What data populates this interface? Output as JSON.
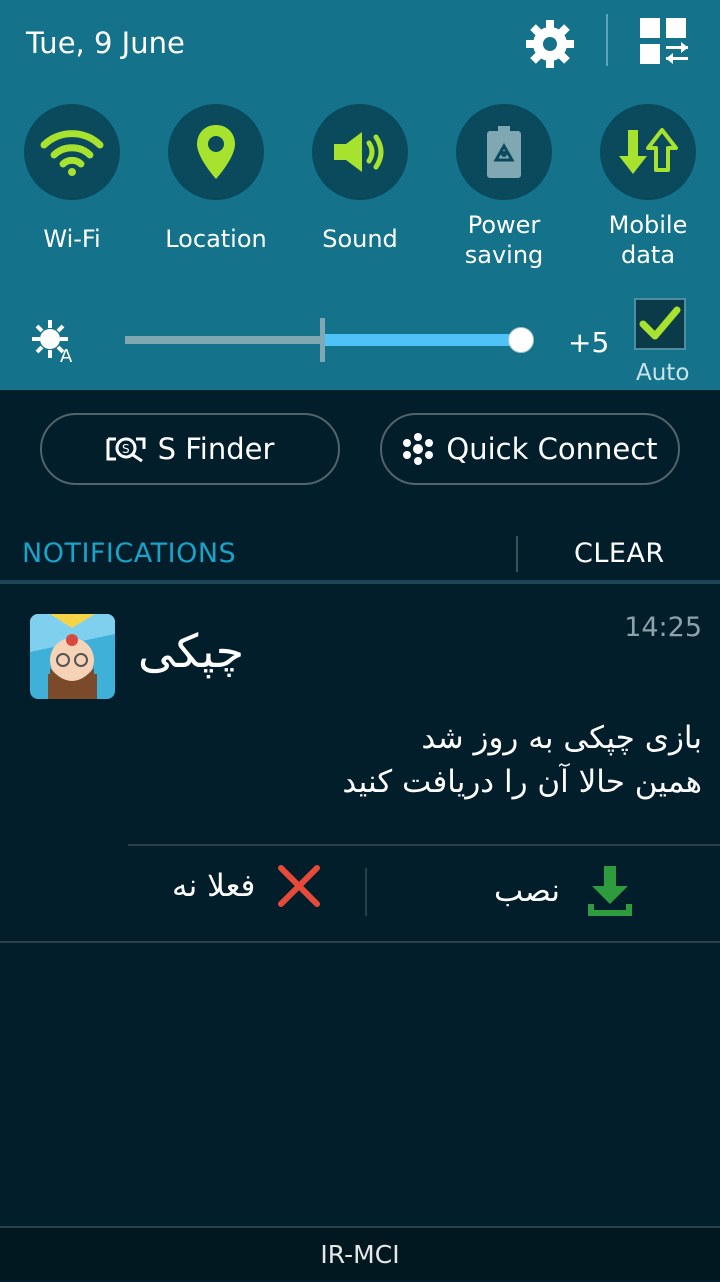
{
  "status": {
    "date": "Tue, 9 June"
  },
  "toggles": [
    {
      "icon": "wifi-icon",
      "label": "Wi-Fi"
    },
    {
      "icon": "location-icon",
      "label": "Location"
    },
    {
      "icon": "sound-icon",
      "label": "Sound"
    },
    {
      "icon": "recycle-battery-icon",
      "label_line1": "Power",
      "label_line2": "saving"
    },
    {
      "icon": "data-arrows-icon",
      "label_line1": "Mobile",
      "label_line2": "data"
    }
  ],
  "brightness": {
    "value_label": "+5",
    "level_fraction": 0.5,
    "auto_label": "Auto",
    "auto_checked": true
  },
  "buttons": {
    "s_finder": "S Finder",
    "quick_connect": "Quick Connect"
  },
  "notifications": {
    "header": "NOTIFICATIONS",
    "clear": "CLEAR",
    "items": [
      {
        "title": "چپکی",
        "time": "14:25",
        "body_line1": "بازی چپکی به روز شد",
        "body_line2": "همین حالا آن را دریافت کنید",
        "actions": [
          {
            "label": "نصب",
            "icon": "download-icon"
          },
          {
            "label": "فعلا نه",
            "icon": "close-icon"
          }
        ]
      }
    ]
  },
  "carrier": "IR-MCI",
  "colors": {
    "panel": "#14738a",
    "accent_green": "#a6e22e",
    "background": "#021e2a",
    "header_blue": "#1aa3c8"
  }
}
